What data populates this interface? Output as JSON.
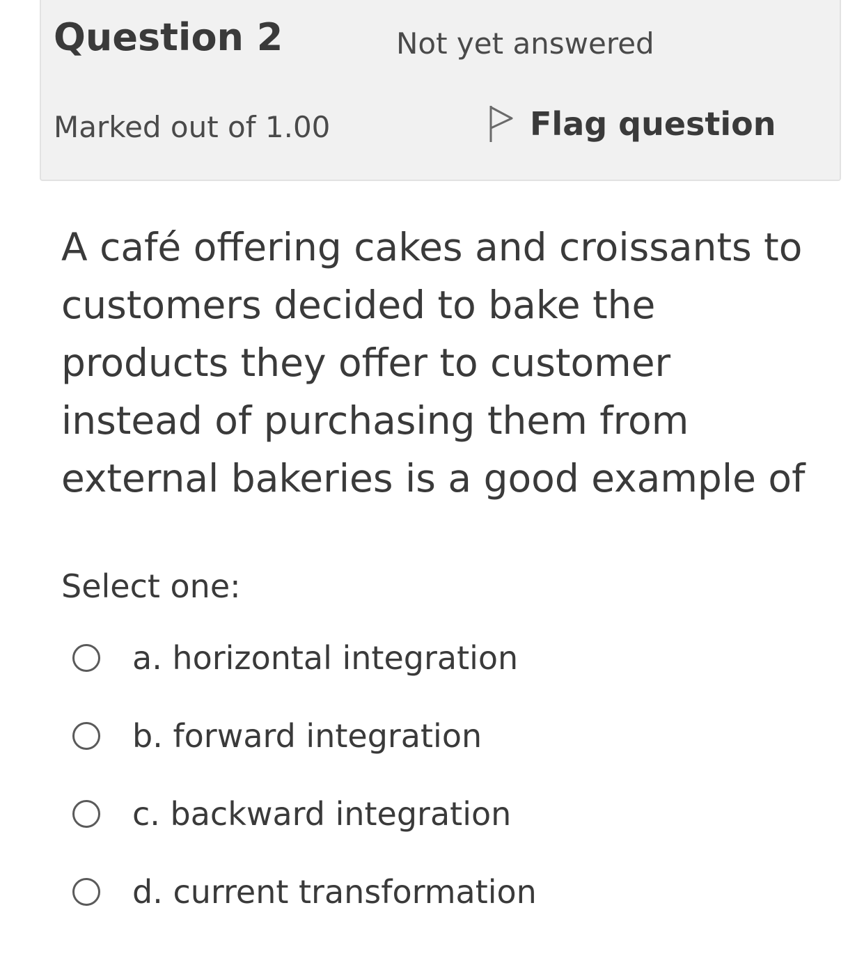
{
  "info": {
    "question_number": "Question 2",
    "state": "Not yet answered",
    "grade": "Marked out of 1.00",
    "flag_label": "Flag question",
    "flag_icon": "flag-outline-icon"
  },
  "question": {
    "text": "A café offering cakes and croissants to customers decided to bake the products they offer to customer instead of purchasing them from external bakeries is a good example of",
    "prompt": "Select one:"
  },
  "options": [
    {
      "label": "a. horizontal integration",
      "selected": false
    },
    {
      "label": "b. forward integration",
      "selected": false
    },
    {
      "label": "c. backward integration",
      "selected": false
    },
    {
      "label": "d. current transformation",
      "selected": false
    }
  ]
}
